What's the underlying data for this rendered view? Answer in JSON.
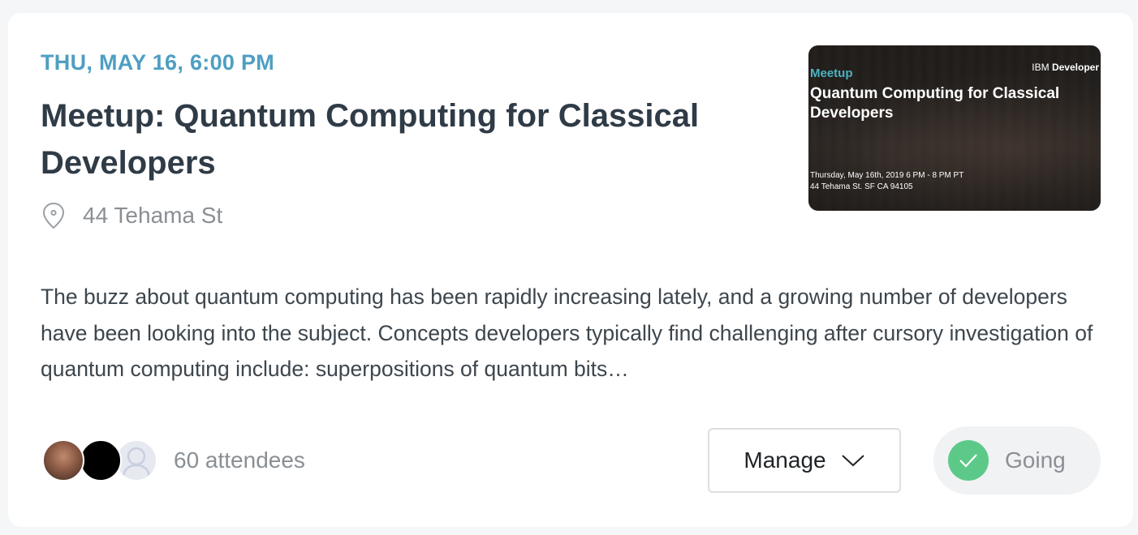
{
  "event": {
    "date": "THU, MAY 16, 6:00 PM",
    "title": "Meetup: Quantum Computing for Classical Developers",
    "location": "44 Tehama St",
    "description": "The buzz about quantum computing has been rapidly increasing lately, and a growing number of developers have been looking into the subject. Concepts developers typically find challenging after cursory investigation of quantum computing include: superpositions of quantum bits…"
  },
  "thumbnail": {
    "brand_prefix": "IBM",
    "brand_suffix": "Developer",
    "kicker": "Meetup",
    "title": "Quantum Computing for Classical Developers",
    "datetime": "Thursday, May 16th, 2019 6 PM - 8 PM PT",
    "address": "44 Tehama St. SF CA 94105"
  },
  "attendees": {
    "count_label": "60 attendees"
  },
  "actions": {
    "manage_label": "Manage",
    "going_label": "Going"
  },
  "colors": {
    "accent": "#4e9fc2",
    "going_check": "#5cc989",
    "title_text": "#2f3b46"
  },
  "icons": {
    "location": "map-pin-icon",
    "manage_caret": "chevron-down-icon",
    "going": "check-circle-icon"
  }
}
